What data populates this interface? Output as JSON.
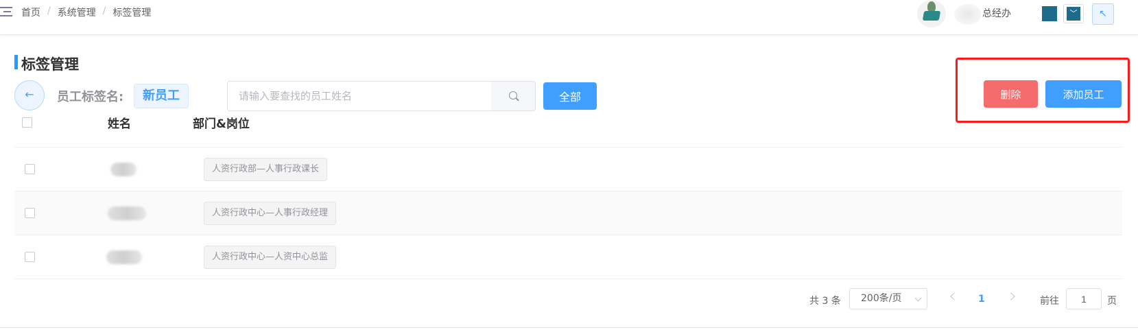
{
  "breadcrumb": {
    "home": "首页",
    "section": "系统管理",
    "current": "标签管理",
    "separator": "/"
  },
  "header": {
    "department": "总经办",
    "collapse_icon": "exit-arrow-icon"
  },
  "page": {
    "title": "标签管理",
    "tag_label": "员工标签名:",
    "tag_value": "新员工"
  },
  "search": {
    "placeholder": "请输入要查找的员工姓名",
    "value": "",
    "all_label": "全部"
  },
  "actions": {
    "delete_label": "删除",
    "add_label": "添加员工"
  },
  "table": {
    "columns": [
      "姓名",
      "部门&岗位"
    ],
    "rows": [
      {
        "name": "",
        "position": "人资行政部—人事行政课长"
      },
      {
        "name": "",
        "position": "人资行政中心—人事行政经理"
      },
      {
        "name": "",
        "position": "人资行政中心—人资中心总监"
      }
    ]
  },
  "pagination": {
    "total": "共 3 条",
    "page_size": "200条/页",
    "current_page": "1",
    "goto_prefix": "前往",
    "goto_value": "1",
    "goto_suffix": "页"
  },
  "colors": {
    "primary": "#409eff",
    "danger": "#f56c6c",
    "highlight": "#ff1a1a",
    "title_accent": "#1e9fff"
  }
}
